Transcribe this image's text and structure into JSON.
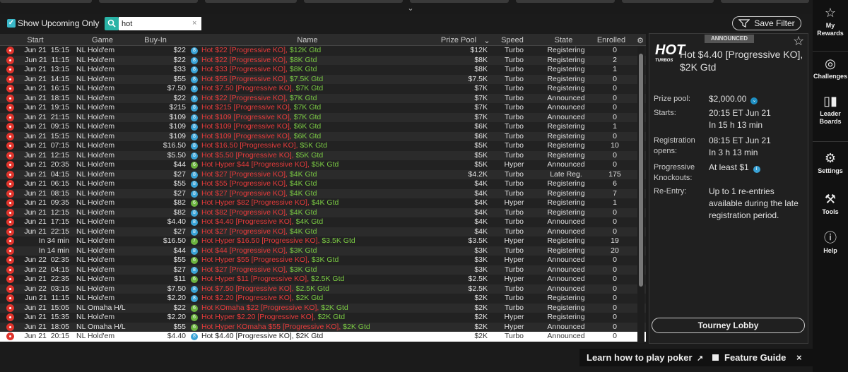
{
  "filters": {
    "show_upcoming_label": "Show Upcoming Only",
    "search_value": "hot",
    "clear_icon": "×",
    "save_filter_label": "Save Filter"
  },
  "columns": [
    "Start",
    "Game",
    "Buy-In",
    "Name",
    "Prize Pool",
    "Speed",
    "State",
    "Enrolled"
  ],
  "rows": [
    {
      "date": "Jun 21",
      "time": "15:15",
      "game": "NL Hold'em",
      "buyin": "$22",
      "badge": "8",
      "name_red": "Hot $22 [Progressive KO],",
      "name_grn": "$12K Gtd",
      "prize": "$12K",
      "speed": "Turbo",
      "state": "Registering",
      "enrolled": "0"
    },
    {
      "date": "Jun 21",
      "time": "11:15",
      "game": "NL Hold'em",
      "buyin": "$22",
      "badge": "8",
      "name_red": "Hot $22 [Progressive KO],",
      "name_grn": "$8K Gtd",
      "prize": "$8K",
      "speed": "Turbo",
      "state": "Registering",
      "enrolled": "2"
    },
    {
      "date": "Jun 21",
      "time": "13:15",
      "game": "NL Hold'em",
      "buyin": "$33",
      "badge": "8",
      "name_red": "Hot $33 [Progressive KO],",
      "name_grn": "$8K Gtd",
      "prize": "$8K",
      "speed": "Turbo",
      "state": "Registering",
      "enrolled": "1"
    },
    {
      "date": "Jun 21",
      "time": "14:15",
      "game": "NL Hold'em",
      "buyin": "$55",
      "badge": "8",
      "name_red": "Hot $55 [Progressive KO],",
      "name_grn": "$7.5K Gtd",
      "prize": "$7.5K",
      "speed": "Turbo",
      "state": "Registering",
      "enrolled": "0"
    },
    {
      "date": "Jun 21",
      "time": "16:15",
      "game": "NL Hold'em",
      "buyin": "$7.50",
      "badge": "8",
      "name_red": "Hot $7.50 [Progressive KO],",
      "name_grn": "$7K Gtd",
      "prize": "$7K",
      "speed": "Turbo",
      "state": "Registering",
      "enrolled": "0"
    },
    {
      "date": "Jun 21",
      "time": "18:15",
      "game": "NL Hold'em",
      "buyin": "$22",
      "badge": "8",
      "name_red": "Hot $22 [Progressive KO],",
      "name_grn": "$7K Gtd",
      "prize": "$7K",
      "speed": "Turbo",
      "state": "Announced",
      "enrolled": "0"
    },
    {
      "date": "Jun 21",
      "time": "19:15",
      "game": "NL Hold'em",
      "buyin": "$215",
      "badge": "8",
      "name_red": "Hot $215 [Progressive KO],",
      "name_grn": "$7K Gtd",
      "prize": "$7K",
      "speed": "Turbo",
      "state": "Announced",
      "enrolled": "0"
    },
    {
      "date": "Jun 21",
      "time": "21:15",
      "game": "NL Hold'em",
      "buyin": "$109",
      "badge": "8",
      "name_red": "Hot $109 [Progressive KO],",
      "name_grn": "$7K Gtd",
      "prize": "$7K",
      "speed": "Turbo",
      "state": "Announced",
      "enrolled": "0"
    },
    {
      "date": "Jun 21",
      "time": "09:15",
      "game": "NL Hold'em",
      "buyin": "$109",
      "badge": "8",
      "name_red": "Hot $109 [Progressive KO],",
      "name_grn": "$6K Gtd",
      "prize": "$6K",
      "speed": "Turbo",
      "state": "Registering",
      "enrolled": "1"
    },
    {
      "date": "Jun 21",
      "time": "15:15",
      "game": "NL Hold'em",
      "buyin": "$109",
      "badge": "8",
      "name_red": "Hot $109 [Progressive KO],",
      "name_grn": "$6K Gtd",
      "prize": "$6K",
      "speed": "Turbo",
      "state": "Registering",
      "enrolled": "0"
    },
    {
      "date": "Jun 21",
      "time": "07:15",
      "game": "NL Hold'em",
      "buyin": "$16.50",
      "badge": "8",
      "name_red": "Hot $16.50 [Progressive KO],",
      "name_grn": "$5K Gtd",
      "prize": "$5K",
      "speed": "Turbo",
      "state": "Registering",
      "enrolled": "10"
    },
    {
      "date": "Jun 21",
      "time": "12:15",
      "game": "NL Hold'em",
      "buyin": "$5.50",
      "badge": "8",
      "name_red": "Hot $5.50 [Progressive KO],",
      "name_grn": "$5K Gtd",
      "prize": "$5K",
      "speed": "Turbo",
      "state": "Registering",
      "enrolled": "0"
    },
    {
      "date": "Jun 21",
      "time": "20:35",
      "game": "NL Hold'em",
      "buyin": "$44",
      "badge": "6",
      "name_red": "Hot Hyper $44 [Progressive KO],",
      "name_grn": "$5K Gtd",
      "prize": "$5K",
      "speed": "Hyper",
      "state": "Announced",
      "enrolled": "0"
    },
    {
      "date": "Jun 21",
      "time": "04:15",
      "game": "NL Hold'em",
      "buyin": "$27",
      "badge": "8",
      "name_red": "Hot $27 [Progressive KO],",
      "name_grn": "$4K Gtd",
      "prize": "$4.2K",
      "speed": "Turbo",
      "state": "Late Reg.",
      "enrolled": "175"
    },
    {
      "date": "Jun 21",
      "time": "06:15",
      "game": "NL Hold'em",
      "buyin": "$55",
      "badge": "8",
      "name_red": "Hot $55 [Progressive KO],",
      "name_grn": "$4K Gtd",
      "prize": "$4K",
      "speed": "Turbo",
      "state": "Registering",
      "enrolled": "6"
    },
    {
      "date": "Jun 21",
      "time": "08:15",
      "game": "NL Hold'em",
      "buyin": "$27",
      "badge": "8",
      "name_red": "Hot $27 [Progressive KO],",
      "name_grn": "$4K Gtd",
      "prize": "$4K",
      "speed": "Turbo",
      "state": "Registering",
      "enrolled": "7"
    },
    {
      "date": "Jun 21",
      "time": "09:35",
      "game": "NL Hold'em",
      "buyin": "$82",
      "badge": "6",
      "name_red": "Hot Hyper $82 [Progressive KO],",
      "name_grn": "$4K Gtd",
      "prize": "$4K",
      "speed": "Hyper",
      "state": "Registering",
      "enrolled": "1"
    },
    {
      "date": "Jun 21",
      "time": "12:15",
      "game": "NL Hold'em",
      "buyin": "$82",
      "badge": "8",
      "name_red": "Hot $82 [Progressive KO],",
      "name_grn": "$4K Gtd",
      "prize": "$4K",
      "speed": "Turbo",
      "state": "Registering",
      "enrolled": "0"
    },
    {
      "date": "Jun 21",
      "time": "17:15",
      "game": "NL Hold'em",
      "buyin": "$4.40",
      "badge": "8",
      "name_red": "Hot $4.40 [Progressive KO],",
      "name_grn": "$4K Gtd",
      "prize": "$4K",
      "speed": "Turbo",
      "state": "Announced",
      "enrolled": "0"
    },
    {
      "date": "Jun 21",
      "time": "22:15",
      "game": "NL Hold'em",
      "buyin": "$27",
      "badge": "8",
      "name_red": "Hot $27 [Progressive KO],",
      "name_grn": "$4K Gtd",
      "prize": "$4K",
      "speed": "Turbo",
      "state": "Announced",
      "enrolled": "0"
    },
    {
      "date": "In 34 min",
      "time": "",
      "game": "NL Hold'em",
      "buyin": "$16.50",
      "badge": "7",
      "name_red": "Hot Hyper $16.50 [Progressive KO],",
      "name_grn": "$3.5K Gtd",
      "prize": "$3.5K",
      "speed": "Hyper",
      "state": "Registering",
      "enrolled": "19"
    },
    {
      "date": "In 14 min",
      "time": "",
      "game": "NL Hold'em",
      "buyin": "$44",
      "badge": "8",
      "name_red": "Hot $44 [Progressive KO],",
      "name_grn": "$3K Gtd",
      "prize": "$3K",
      "speed": "Turbo",
      "state": "Registering",
      "enrolled": "20"
    },
    {
      "date": "Jun 22",
      "time": "02:35",
      "game": "NL Hold'em",
      "buyin": "$55",
      "badge": "6",
      "name_red": "Hot Hyper $55 [Progressive KO],",
      "name_grn": "$3K Gtd",
      "prize": "$3K",
      "speed": "Hyper",
      "state": "Announced",
      "enrolled": "0"
    },
    {
      "date": "Jun 22",
      "time": "04:15",
      "game": "NL Hold'em",
      "buyin": "$27",
      "badge": "8",
      "name_red": "Hot $27 [Progressive KO],",
      "name_grn": "$3K Gtd",
      "prize": "$3K",
      "speed": "Turbo",
      "state": "Announced",
      "enrolled": "0"
    },
    {
      "date": "Jun 21",
      "time": "22:35",
      "game": "NL Hold'em",
      "buyin": "$11",
      "badge": "6",
      "name_red": "Hot Hyper $11 [Progressive KO],",
      "name_grn": "$2.5K Gtd",
      "prize": "$2.5K",
      "speed": "Hyper",
      "state": "Announced",
      "enrolled": "0"
    },
    {
      "date": "Jun 22",
      "time": "03:15",
      "game": "NL Hold'em",
      "buyin": "$7.50",
      "badge": "8",
      "name_red": "Hot $7.50 [Progressive KO],",
      "name_grn": "$2.5K Gtd",
      "prize": "$2.5K",
      "speed": "Turbo",
      "state": "Announced",
      "enrolled": "0"
    },
    {
      "date": "Jun 21",
      "time": "11:15",
      "game": "NL Hold'em",
      "buyin": "$2.20",
      "badge": "8",
      "name_red": "Hot $2.20 [Progressive KO],",
      "name_grn": "$2K Gtd",
      "prize": "$2K",
      "speed": "Turbo",
      "state": "Registering",
      "enrolled": "0"
    },
    {
      "date": "Jun 21",
      "time": "15:05",
      "game": "NL Omaha H/L",
      "buyin": "$22",
      "badge": "6",
      "name_red": "Hot KOmaha $22 [Progressive KO],",
      "name_grn": "$2K Gtd",
      "prize": "$2K",
      "speed": "Turbo",
      "state": "Registering",
      "enrolled": "0"
    },
    {
      "date": "Jun 21",
      "time": "15:35",
      "game": "NL Hold'em",
      "buyin": "$2.20",
      "badge": "6",
      "name_red": "Hot Hyper $2.20 [Progressive KO],",
      "name_grn": "$2K Gtd",
      "prize": "$2K",
      "speed": "Hyper",
      "state": "Registering",
      "enrolled": "0"
    },
    {
      "date": "Jun 21",
      "time": "18:05",
      "game": "NL Omaha H/L",
      "buyin": "$55",
      "badge": "6",
      "name_red": "Hot Hyper KOmaha $55 [Progressive KO],",
      "name_grn": "$2K Gtd",
      "prize": "$2K",
      "speed": "Hyper",
      "state": "Announced",
      "enrolled": "0"
    },
    {
      "date": "Jun 21",
      "time": "20:15",
      "game": "NL Hold'em",
      "buyin": "$4.40",
      "badge": "8",
      "name_red": "Hot $4.40 [Progressive KO],",
      "name_grn": "$2K Gtd",
      "prize": "$2K",
      "speed": "Turbo",
      "state": "Announced",
      "enrolled": "0",
      "selected": true
    }
  ],
  "panel": {
    "tag": "ANNOUNCED",
    "logo_text": "HOT",
    "logo_sub": "TURBOS",
    "title": "Hot $4.40 [Progressive KO], $2K Gtd",
    "prize_label": "Prize pool:",
    "prize_value": "$2,000.00",
    "starts_label": "Starts:",
    "starts_value": "20:15 ET Jun 21",
    "starts_rel": "In 15 h 13 min",
    "reg_label_1": "Registration",
    "reg_label_2": "opens:",
    "reg_value": "08:15 ET Jun 21",
    "reg_rel": "In 3 h 13 min",
    "pko_label_1": "Progressive",
    "pko_label_2": "Knockouts:",
    "pko_value": "At least $1",
    "reentry_label": "Re-Entry:",
    "reentry_value_1": "Up to 1 re-entries",
    "reentry_value_2": "available during the late",
    "reentry_value_3": "registration period.",
    "lobby_button": "Tourney Lobby"
  },
  "sidebar": {
    "rewards_1": "My",
    "rewards_2": "Rewards",
    "challenges": "Challenges",
    "leader_1": "Leader",
    "leader_2": "Boards",
    "settings": "Settings",
    "tools": "Tools",
    "help": "Help"
  },
  "footer": {
    "learn": "Learn how to play poker",
    "feature": "Feature Guide",
    "close": "×"
  },
  "colors": {
    "red": "#e83b3b",
    "green": "#7ac943",
    "accent": "#2ab3a6",
    "badge_blue": "#3aa3d6",
    "badge_green": "#6cb33f"
  }
}
